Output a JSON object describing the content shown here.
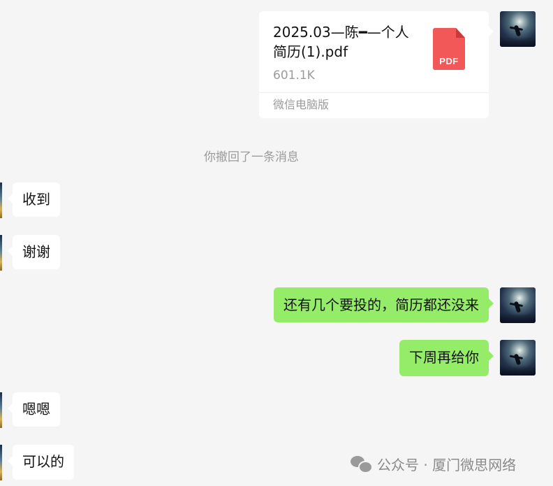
{
  "file_message": {
    "file_name": "2025.03—陈━—个人简历(1).pdf",
    "file_size": "601.1K",
    "source": "微信电脑版",
    "file_type_label": "PDF",
    "icon": "pdf-file-icon",
    "icon_color": "#f25858"
  },
  "system_notice": "你撤回了一条消息",
  "messages": [
    {
      "side": "left",
      "text": "收到"
    },
    {
      "side": "left",
      "text": "谢谢"
    },
    {
      "side": "right",
      "text": "还有几个要投的，简历都还没来"
    },
    {
      "side": "right",
      "text": "下周再给你"
    },
    {
      "side": "left",
      "text": "嗯嗯"
    },
    {
      "side": "left",
      "text": "可以的"
    }
  ],
  "watermark": {
    "text": "公众号 · 厦门微思网络",
    "icon": "wechat-icon"
  },
  "colors": {
    "background": "#f5f5f5",
    "sent_bubble": "#95ec69",
    "received_bubble": "#ffffff",
    "meta_text": "#9b9b9b"
  }
}
